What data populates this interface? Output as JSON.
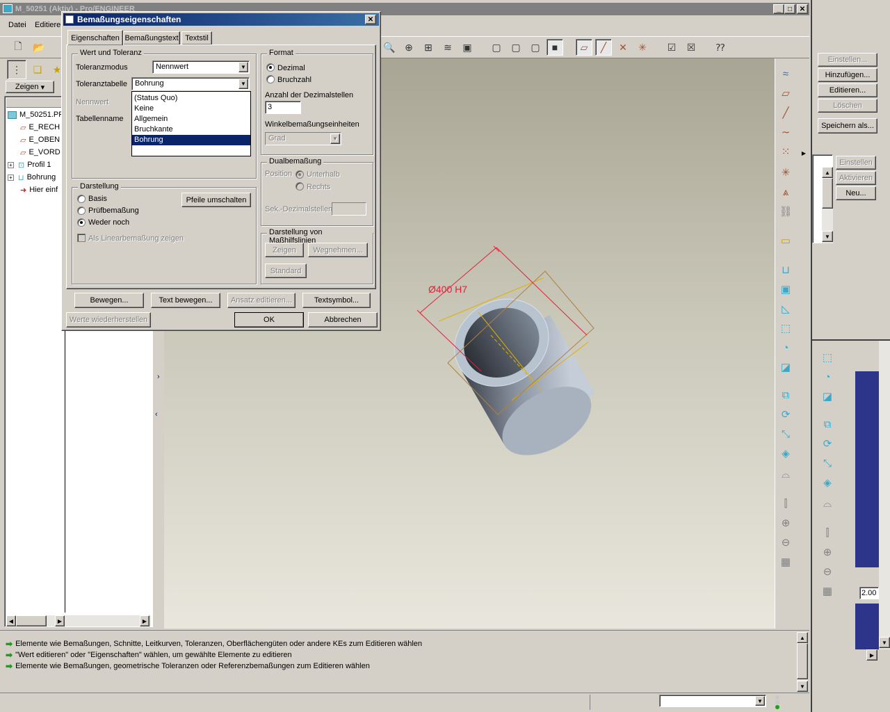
{
  "main_window": {
    "title": "M_50251 (Aktiv) - Pro/ENGINEER",
    "menu": [
      "Datei",
      "Editieren"
    ]
  },
  "nav": {
    "zeigen_label": "Zeigen",
    "tree_items": [
      "M_50251.PR",
      "E_RECH",
      "E_OBEN",
      "E_VORD",
      "Profil 1",
      "Bohrung",
      "Hier einf"
    ]
  },
  "model_view": {
    "dimension_label": "Ø400 H7"
  },
  "messages": [
    "Elemente wie Bemaßungen, Schnitte, Leitkurven, Toleranzen, Oberflächengüten oder andere KEs zum Editieren wählen",
    "\"Wert editieren\" oder \"Eigenschaften\" wählen, um gewählte Elemente zu editieren",
    "Elemente wie Bemaßungen, geometrische Toleranzen oder Referenzbemaßungen zum Editieren wählen"
  ],
  "right_panel": {
    "buttons": [
      "Einstellen...",
      "Hinzufügen...",
      "Editieren...",
      "Löschen",
      "Speichern als..."
    ],
    "buttons2": [
      "Einstellen",
      "Aktivieren",
      "Neu..."
    ],
    "value_field": "2.00"
  },
  "dialog": {
    "title": "Bemaßungseigenschaften",
    "tabs": [
      "Eigenschaften",
      "Bemaßungstext",
      "Textstil"
    ],
    "wert_group": {
      "title": "Wert und Toleranz",
      "toleranzmodus_label": "Toleranzmodus",
      "toleranzmodus_value": "Nennwert",
      "toleranztabelle_label": "Toleranztabelle",
      "toleranztabelle_value": "Bohrung",
      "nennwert_label": "Nennwert",
      "tabellenname_label": "Tabellenname",
      "dropdown_options": [
        "(Status Quo)",
        "Keine",
        "Allgemein",
        "Bruchkante",
        "Bohrung"
      ],
      "selected_option": "Bohrung"
    },
    "format_group": {
      "title": "Format",
      "dezimal": "Dezimal",
      "bruchzahl": "Bruchzahl",
      "anzahl_label": "Anzahl der Dezimalstellen",
      "anzahl_value": "3",
      "winkel_label": "Winkelbemaßungseinheiten",
      "winkel_value": "Grad"
    },
    "dual_group": {
      "title": "Dualbemaßung",
      "position_label": "Position",
      "unterhalb": "Unterhalb",
      "rechts": "Rechts",
      "sek_label": "Sek.-Dezimalstellen"
    },
    "darstellung_group": {
      "title": "Darstellung",
      "basis": "Basis",
      "pruef": "Prüfbemaßung",
      "weder": "Weder noch",
      "pfeile": "Pfeile umschalten",
      "als_linear": "Als Linearbemaßung zeigen"
    },
    "masshilf_group": {
      "title": "Darstellung von Maßhilfslinien",
      "zeigen": "Zeigen",
      "wegnehmen": "Wegnehmen...",
      "standard": "Standard"
    },
    "buttons": {
      "bewegen": "Bewegen...",
      "text_bewegen": "Text bewegen...",
      "ansatz": "Ansatz editieren...",
      "textsymbol": "Textsymbol...",
      "werte": "Werte wiederherstellen",
      "ok": "OK",
      "abbrechen": "Abbrechen"
    }
  },
  "colors": {
    "title_active": "#0a246a",
    "selection": "#0a246a",
    "viewport_top": "#a8a594",
    "viewport_bottom": "#e9e7dd",
    "dimension": "#e0203a",
    "axis": "#e0b000",
    "panel_blue": "#2c3589"
  }
}
